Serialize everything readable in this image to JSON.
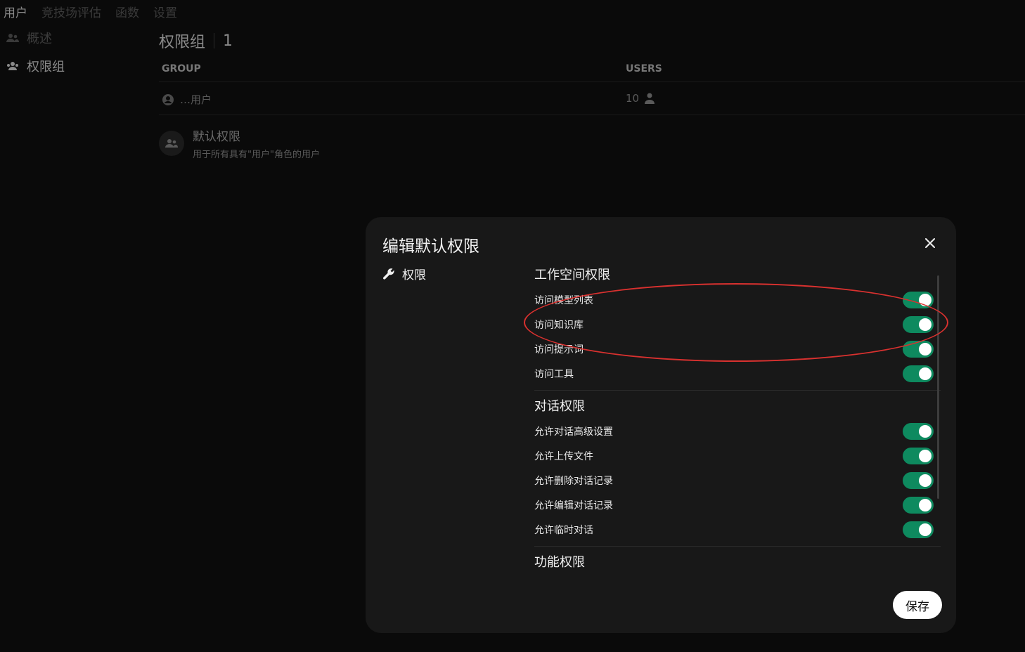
{
  "top_tabs": [
    {
      "label": "用户",
      "active": true
    },
    {
      "label": "竞技场评估",
      "active": false
    },
    {
      "label": "函数",
      "active": false
    },
    {
      "label": "设置",
      "active": false
    }
  ],
  "sidebar": {
    "items": [
      {
        "label": "概述",
        "icon": "users-icon",
        "active": false
      },
      {
        "label": "权限组",
        "icon": "user-group-icon",
        "active": true
      }
    ]
  },
  "main": {
    "title": "权限组",
    "count": "1",
    "table": {
      "headers": {
        "group": "GROUP",
        "users": "USERS"
      },
      "rows": [
        {
          "name": "…用户",
          "users": "10"
        }
      ]
    },
    "default_permissions": {
      "title": "默认权限",
      "description": "用于所有具有\"用户\"角色的用户"
    }
  },
  "modal": {
    "title": "编辑默认权限",
    "tab_label": "权限",
    "sections": [
      {
        "title": "工作空间权限",
        "items": [
          {
            "label": "访问模型列表",
            "enabled": true
          },
          {
            "label": "访问知识库",
            "enabled": true
          },
          {
            "label": "访问提示词",
            "enabled": true
          },
          {
            "label": "访问工具",
            "enabled": true
          }
        ]
      },
      {
        "title": "对话权限",
        "items": [
          {
            "label": "允许对话高级设置",
            "enabled": true
          },
          {
            "label": "允许上传文件",
            "enabled": true
          },
          {
            "label": "允许删除对话记录",
            "enabled": true
          },
          {
            "label": "允许编辑对话记录",
            "enabled": true
          },
          {
            "label": "允许临时对话",
            "enabled": true
          }
        ]
      },
      {
        "title": "功能权限",
        "items": []
      }
    ],
    "save_label": "保存"
  },
  "colors": {
    "toggle_on": "#0e8a5f",
    "annotation": "#d9312f",
    "modal_bg": "#181818"
  }
}
